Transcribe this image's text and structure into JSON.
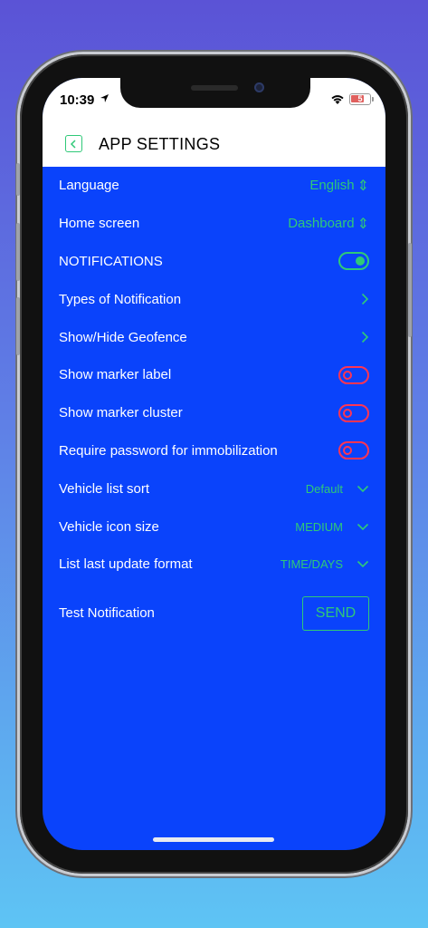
{
  "status_bar": {
    "time": "10:39",
    "battery": "5"
  },
  "header": {
    "title": "APP SETTINGS",
    "back_icon": "chevron-left-icon"
  },
  "settings": {
    "language": {
      "label": "Language",
      "value": "English"
    },
    "home_screen": {
      "label": "Home screen",
      "value": "Dashboard"
    },
    "notifications": {
      "label": "NOTIFICATIONS",
      "enabled": true
    },
    "types_of_notification": {
      "label": "Types of Notification"
    },
    "show_hide_geofence": {
      "label": "Show/Hide Geofence"
    },
    "show_marker_label": {
      "label": "Show marker label",
      "enabled": false
    },
    "show_marker_cluster": {
      "label": "Show marker cluster",
      "enabled": false
    },
    "require_password": {
      "label": "Require password for immobilization",
      "enabled": false
    },
    "vehicle_list_sort": {
      "label": "Vehicle list sort",
      "value": "Default"
    },
    "vehicle_icon_size": {
      "label": "Vehicle icon size",
      "value": "MEDIUM"
    },
    "list_last_update_format": {
      "label": "List last update format",
      "value": "TIME/DAYS"
    },
    "test_notification": {
      "label": "Test Notification",
      "button": "SEND"
    }
  },
  "colors": {
    "background": "#0a43fb",
    "accent_green": "#2fc978",
    "toggle_off_red": "#ff3553",
    "header_bg": "#ffffff"
  }
}
